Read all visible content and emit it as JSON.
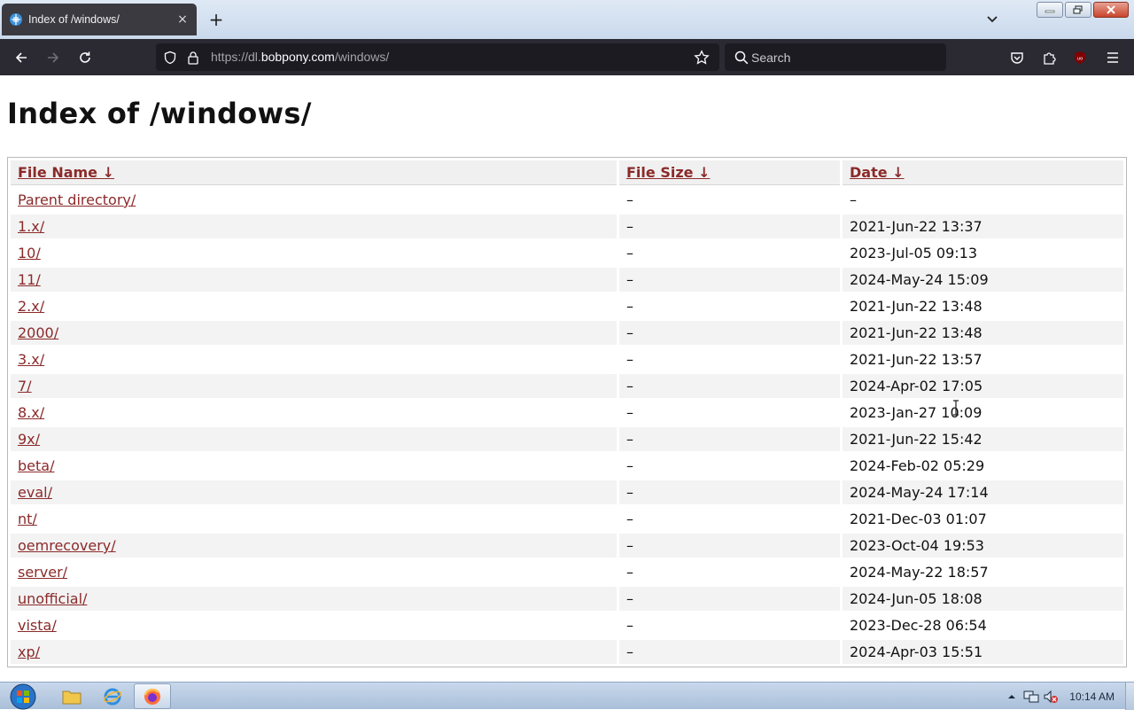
{
  "browser": {
    "tab": {
      "title": "Index of /windows/",
      "close": "×"
    },
    "new_tab": "+",
    "url": {
      "prefix": "https://dl.",
      "host": "bobpony.com",
      "path": "/windows/"
    },
    "search": {
      "placeholder": "Search"
    },
    "ublock_badge": "uo"
  },
  "page": {
    "title": "Index of /windows/",
    "columns": {
      "name": "File Name  ↓",
      "size": "File Size  ↓",
      "date": "Date  ↓"
    },
    "rows": [
      {
        "name": "Parent directory/",
        "size": "–",
        "date": "–"
      },
      {
        "name": "1.x/",
        "size": "–",
        "date": "2021-Jun-22 13:37"
      },
      {
        "name": "10/",
        "size": "–",
        "date": "2023-Jul-05 09:13"
      },
      {
        "name": "11/",
        "size": "–",
        "date": "2024-May-24 15:09"
      },
      {
        "name": "2.x/",
        "size": "–",
        "date": "2021-Jun-22 13:48"
      },
      {
        "name": "2000/",
        "size": "–",
        "date": "2021-Jun-22 13:48"
      },
      {
        "name": "3.x/",
        "size": "–",
        "date": "2021-Jun-22 13:57"
      },
      {
        "name": "7/",
        "size": "–",
        "date": "2024-Apr-02 17:05"
      },
      {
        "name": "8.x/",
        "size": "–",
        "date": "2023-Jan-27 10:09"
      },
      {
        "name": "9x/",
        "size": "–",
        "date": "2021-Jun-22 15:42"
      },
      {
        "name": "beta/",
        "size": "–",
        "date": "2024-Feb-02 05:29"
      },
      {
        "name": "eval/",
        "size": "–",
        "date": "2024-May-24 17:14"
      },
      {
        "name": "nt/",
        "size": "–",
        "date": "2021-Dec-03 01:07"
      },
      {
        "name": "oemrecovery/",
        "size": "–",
        "date": "2023-Oct-04 19:53"
      },
      {
        "name": "server/",
        "size": "–",
        "date": "2024-May-22 18:57"
      },
      {
        "name": "unofficial/",
        "size": "–",
        "date": "2024-Jun-05 18:08"
      },
      {
        "name": "vista/",
        "size": "–",
        "date": "2023-Dec-28 06:54"
      },
      {
        "name": "xp/",
        "size": "–",
        "date": "2024-Apr-03 15:51"
      }
    ]
  },
  "taskbar": {
    "clock": "10:14 AM"
  },
  "colors": {
    "link": "#8b2a2a",
    "toolbar": "#2b2a33",
    "urlbar": "#1c1b22"
  }
}
